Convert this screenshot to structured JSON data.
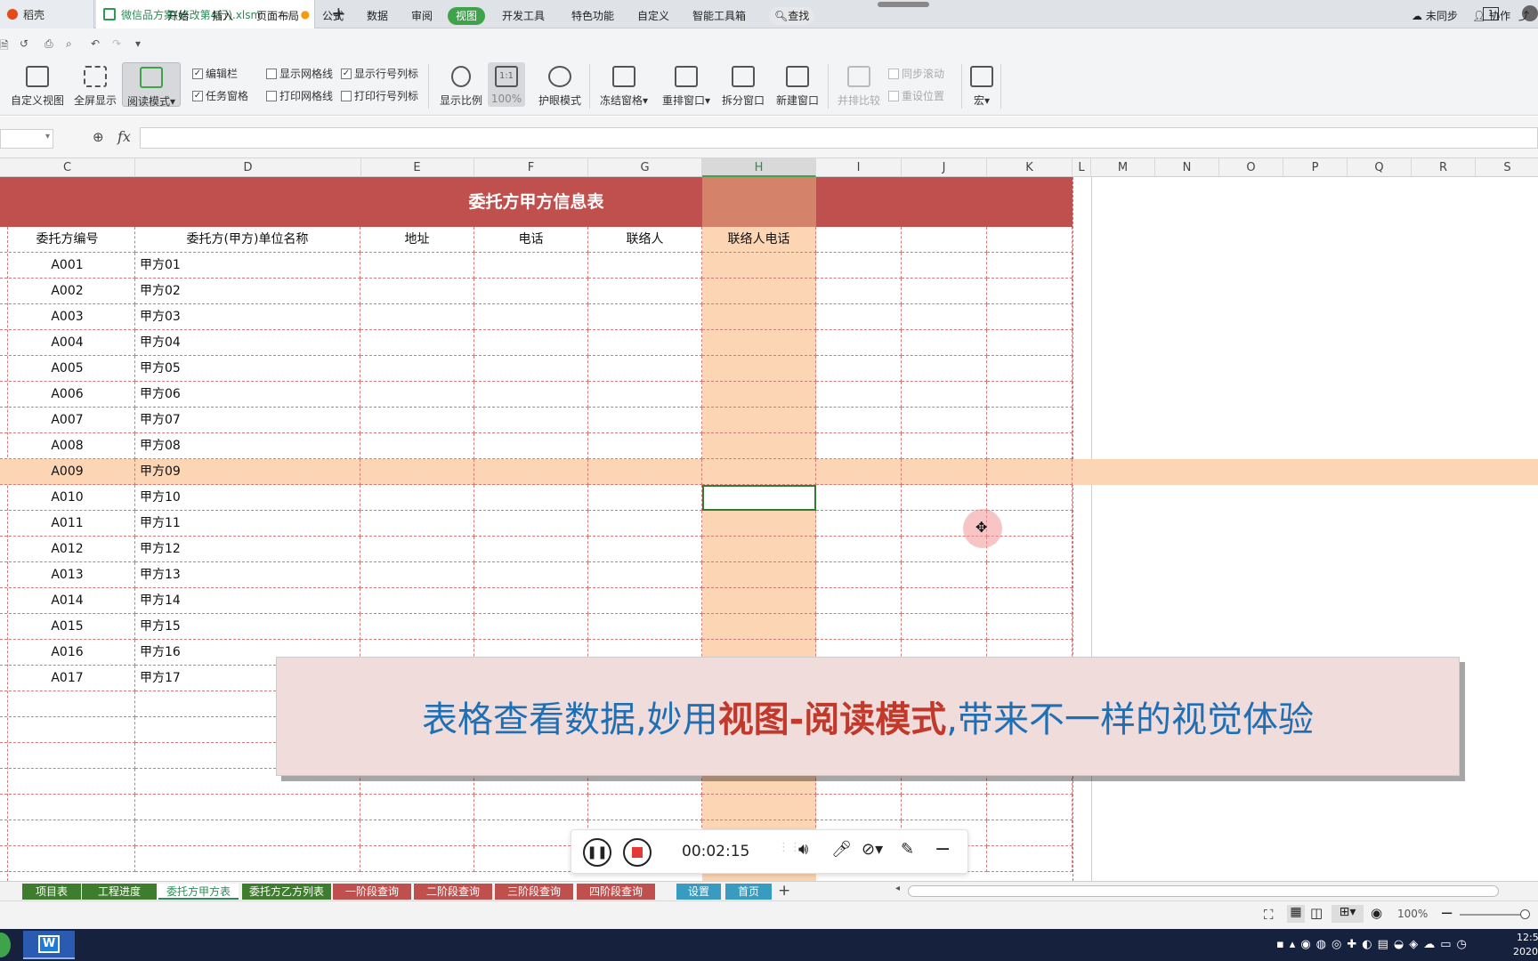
{
  "titlebar": {
    "tab1_label": "稻壳",
    "tab2_label": "微信品方案(修改第4行).xlsm",
    "new_tab_symbol": "+",
    "window_badge": "1"
  },
  "menu": {
    "items": [
      "开始",
      "插入",
      "页面布局",
      "公式",
      "数据",
      "审阅",
      "视图",
      "开发工具",
      "特色功能",
      "自定义",
      "智能工具箱"
    ],
    "active": "视图",
    "search_label": "查找",
    "sync_label": "未同步",
    "collab_label": "协作"
  },
  "ribbon": {
    "custom_view": "自定义视图",
    "fullscreen": "全屏显示",
    "read_mode": "阅读模式",
    "edit_bar": "编辑栏",
    "task_pane": "任务窗格",
    "show_gridlines": "显示网格线",
    "print_gridlines": "打印网格线",
    "show_headers": "显示行号列标",
    "print_headers": "打印行号列标",
    "zoom_ratio": "显示比例",
    "zoom_100": "100%",
    "zoom_11": "1:1",
    "eye_mode": "护眼模式",
    "freeze": "冻结窗格",
    "arrange": "重排窗口",
    "split": "拆分窗口",
    "new_window": "新建窗口",
    "side_by_side": "并排比较",
    "sync_scroll": "同步滚动",
    "reset_pos": "重设位置",
    "macro": "宏"
  },
  "formula": {
    "fx": "fx",
    "value": ""
  },
  "columns": [
    "C",
    "D",
    "E",
    "F",
    "G",
    "H",
    "I",
    "J",
    "K",
    "L",
    "M",
    "N",
    "O",
    "P",
    "Q",
    "R",
    "S"
  ],
  "sheet": {
    "title": "委托方甲方信息表",
    "headers": [
      "委托方编号",
      "委托方(甲方)单位名称",
      "地址",
      "电话",
      "联络人",
      "联络人电话"
    ],
    "rows": [
      {
        "id": "A001",
        "name": "甲方01"
      },
      {
        "id": "A002",
        "name": "甲方02"
      },
      {
        "id": "A003",
        "name": "甲方03"
      },
      {
        "id": "A004",
        "name": "甲方04"
      },
      {
        "id": "A005",
        "name": "甲方05"
      },
      {
        "id": "A006",
        "name": "甲方06"
      },
      {
        "id": "A007",
        "name": "甲方07"
      },
      {
        "id": "A008",
        "name": "甲方08"
      },
      {
        "id": "A009",
        "name": "甲方09"
      },
      {
        "id": "A010",
        "name": "甲方10"
      },
      {
        "id": "A011",
        "name": "甲方11"
      },
      {
        "id": "A012",
        "name": "甲方12"
      },
      {
        "id": "A013",
        "name": "甲方13"
      },
      {
        "id": "A014",
        "name": "甲方14"
      },
      {
        "id": "A015",
        "name": "甲方15"
      },
      {
        "id": "A016",
        "name": "甲方16"
      },
      {
        "id": "A017",
        "name": "甲方17"
      }
    ]
  },
  "sheet_tabs": [
    {
      "label": "项目表",
      "color": "#3f7d2e"
    },
    {
      "label": "工程进度",
      "color": "#3f7d2e"
    },
    {
      "label": "委托方甲方表",
      "color": "#ffffff",
      "active": true
    },
    {
      "label": "委托方乙方列表",
      "color": "#3f7d2e"
    },
    {
      "label": "一阶段查询",
      "color": "#c0504d"
    },
    {
      "label": "二阶段查询",
      "color": "#c0504d"
    },
    {
      "label": "三阶段查询",
      "color": "#c0504d"
    },
    {
      "label": "四阶段查询",
      "color": "#c0504d"
    },
    {
      "label": "设置",
      "color": "#3a9bc0"
    },
    {
      "label": "首页",
      "color": "#3a9bc0"
    }
  ],
  "status": {
    "zoom": "100%"
  },
  "recorder": {
    "time": "00:02:15"
  },
  "caption": {
    "part1": "表格查看数据,妙用",
    "part2": "视图-阅读模式",
    "part3": ",带来不一样的视觉体验"
  },
  "taskbar": {
    "time": "12:5",
    "date": "2020"
  },
  "colors": {
    "header_red": "#c0504d",
    "highlight": "#fcd5b4",
    "highlight_header": "#d4826a",
    "active_green": "#3ea34a"
  }
}
